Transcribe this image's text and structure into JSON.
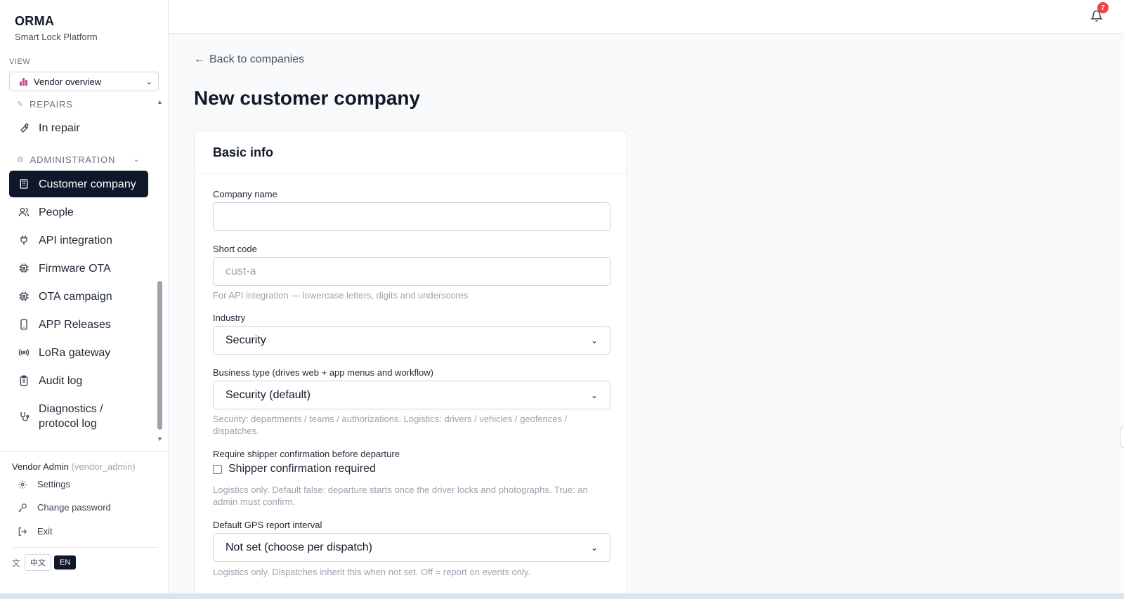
{
  "brand": {
    "title": "ORMA",
    "subtitle": "Smart Lock Platform"
  },
  "view": {
    "label": "VIEW",
    "selected": "Vendor overview"
  },
  "sidebar": {
    "sections": [
      {
        "label": "REPAIRS"
      },
      {
        "label": "ADMINISTRATION"
      }
    ],
    "items": [
      {
        "label": "In repair",
        "icon": "wrench-icon"
      },
      {
        "label": "Customer company",
        "icon": "building-icon",
        "active": true
      },
      {
        "label": "People",
        "icon": "people-icon"
      },
      {
        "label": "API integration",
        "icon": "plug-icon"
      },
      {
        "label": "Firmware OTA",
        "icon": "chip-icon"
      },
      {
        "label": "OTA campaign",
        "icon": "chip-icon"
      },
      {
        "label": "APP Releases",
        "icon": "phone-icon"
      },
      {
        "label": "LoRa gateway",
        "icon": "radio-icon"
      },
      {
        "label": "Audit log",
        "icon": "clipboard-icon"
      },
      {
        "label": "Diagnostics /",
        "label2": "protocol log",
        "icon": "stethoscope-icon"
      }
    ]
  },
  "footer": {
    "user_name": "Vendor Admin",
    "user_role": "(vendor_admin)",
    "links": [
      {
        "label": "Settings",
        "icon": "gear-icon"
      },
      {
        "label": "Change password",
        "icon": "key-icon"
      },
      {
        "label": "Exit",
        "icon": "exit-icon"
      }
    ],
    "languages": [
      "中文",
      "EN"
    ],
    "active_language": "EN"
  },
  "topbar": {
    "notification_count": "7"
  },
  "main": {
    "back_label": "Back to companies",
    "title": "New customer company",
    "card_title": "Basic info",
    "fields": {
      "company_name": {
        "label": "Company name",
        "value": ""
      },
      "short_code": {
        "label": "Short code",
        "placeholder": "cust-a",
        "hint": "For API integration — lowercase letters, digits and underscores"
      },
      "industry": {
        "label": "Industry",
        "value": "Security"
      },
      "business_type": {
        "label": "Business type (drives web + app menus and workflow)",
        "value": "Security (default)",
        "hint": "Security: departments / teams / authorizations. Logistics: drivers / vehicles / geofences / dispatches."
      },
      "shipper": {
        "label": "Require shipper confirmation before departure",
        "checkbox_label": "Shipper confirmation required",
        "checked": false,
        "hint": "Logistics only. Default false: departure starts once the driver locks and photographs. True: an admin must confirm."
      },
      "gps_interval": {
        "label": "Default GPS report interval",
        "value": "Not set (choose per dispatch)",
        "hint": "Logistics only. Dispatches inherit this when not set. Off = report on events only."
      }
    }
  },
  "colors": {
    "active_nav_bg": "#0f172a",
    "badge": "#ef4444"
  }
}
